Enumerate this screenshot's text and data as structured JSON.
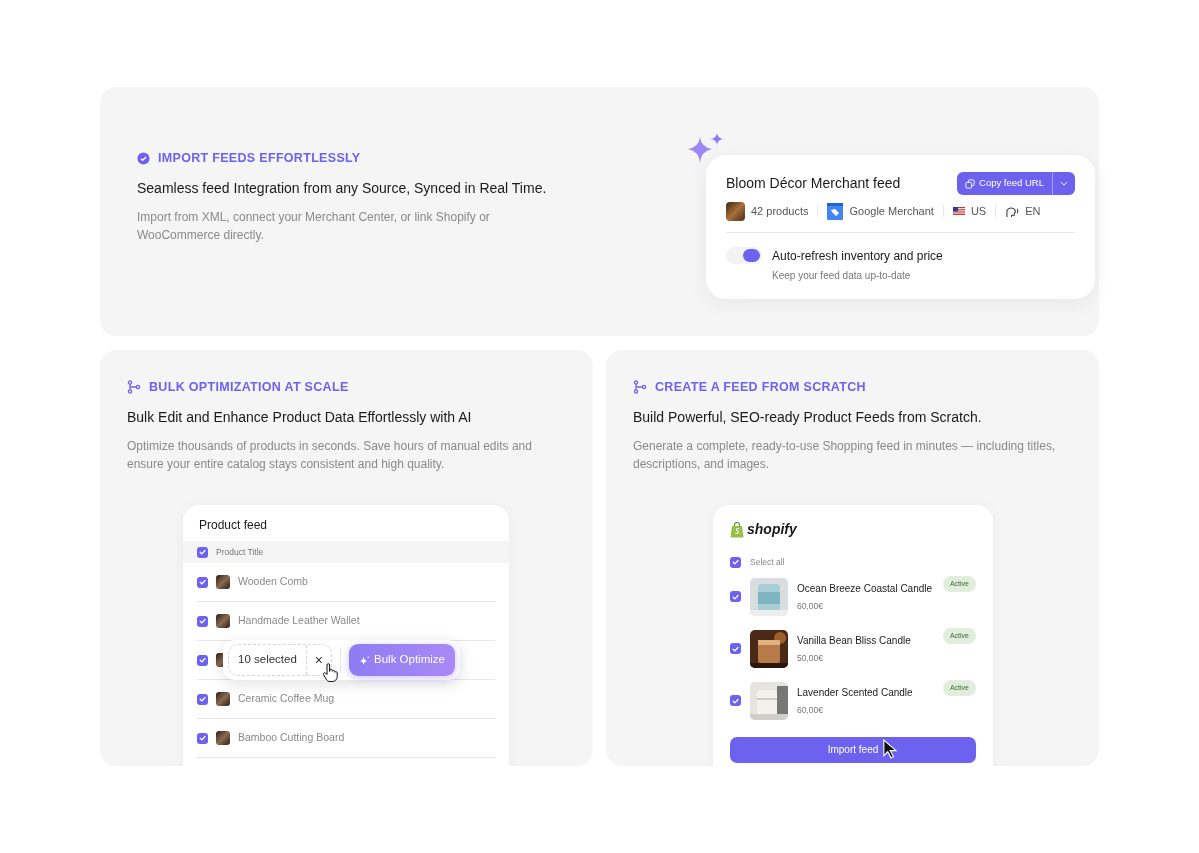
{
  "import_section": {
    "eyebrow": "IMPORT FEEDS EFFORTLESSLY",
    "heading": "Seamless feed Integration from any Source, Synced in Real Time.",
    "description": "Import from XML, connect your Merchant Center, or link Shopify or WooCommerce directly.",
    "feed_card": {
      "title": "Bloom Décor Merchant feed",
      "copy_button": "Copy feed URL",
      "products": "42 products",
      "source": "Google Merchant",
      "country": "US",
      "language": "EN",
      "toggle": {
        "label": "Auto-refresh inventory and price",
        "hint": "Keep your feed data up-to-date",
        "on": true
      }
    }
  },
  "bulk_section": {
    "eyebrow": "BULK OPTIMIZATION AT SCALE",
    "heading": "Bulk Edit and Enhance Product Data Effortlessly with AI",
    "description": "Optimize thousands of products in seconds. Save hours of manual edits and ensure your entire catalog stays consistent and high quality.",
    "table": {
      "title": "Product feed",
      "column": "Product Title",
      "header_checked": true,
      "rows": [
        {
          "name": "Wooden Comb",
          "checked": true
        },
        {
          "name": "Handmade Leather Wallet",
          "checked": true
        },
        {
          "checked": true
        },
        {
          "name": "Ceramic Coffee Mug",
          "checked": true
        },
        {
          "name": "Bamboo Cutting Board",
          "checked": true
        }
      ]
    },
    "selection_bar": {
      "count": "10 selected",
      "close": "×",
      "action": "Bulk Optimize"
    }
  },
  "scratch_section": {
    "eyebrow": "CREATE A FEED FROM SCRATCH",
    "heading": "Build Powerful, SEO-ready Product Feeds from Scratch.",
    "description": "Generate a complete, ready-to-use Shopping feed in minutes — including titles, descriptions, and images.",
    "store": {
      "brand": "shopify",
      "select_all": {
        "label": "Select all",
        "checked": true
      },
      "products": [
        {
          "name": "Ocean Breeze Coastal Candle",
          "price": "60,00€",
          "status": "Active",
          "checked": true
        },
        {
          "name": "Vanilla Bean Bliss Candle",
          "price": "50,00€",
          "status": "Active",
          "checked": true
        },
        {
          "name": "Lavender Scented Candle",
          "price": "60,00€",
          "status": "Active",
          "checked": true
        }
      ],
      "button": "Import feed"
    }
  }
}
